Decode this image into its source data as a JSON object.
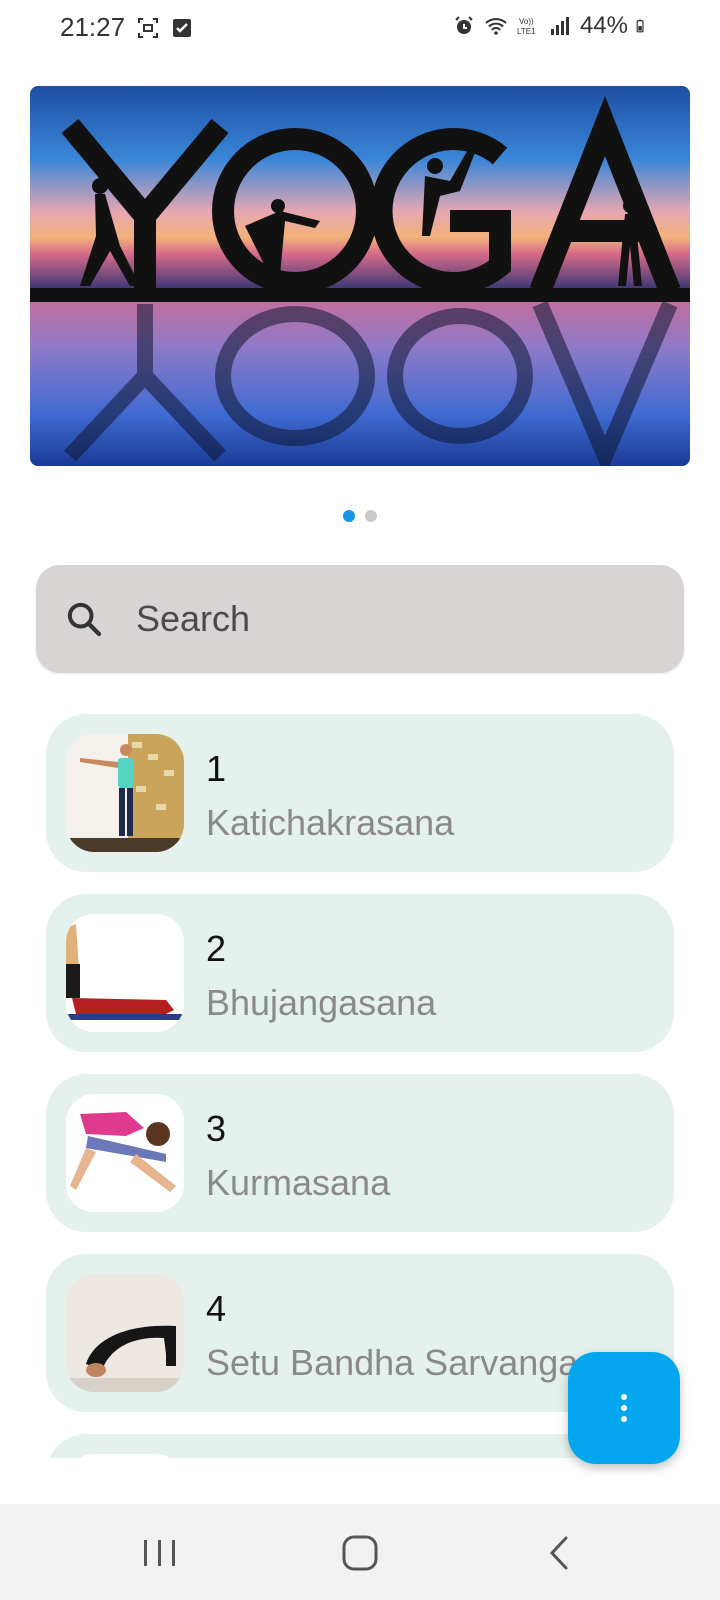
{
  "status_bar": {
    "time": "21:27",
    "battery": "44%",
    "icons": [
      "screenshot-icon",
      "checkbox-icon",
      "alarm-icon",
      "wifi-icon",
      "volte-icon",
      "signal-icon",
      "battery-icon"
    ]
  },
  "banner": {
    "image": "yoga-banner",
    "pages": 2,
    "active_page": 1
  },
  "search": {
    "placeholder": "Search"
  },
  "list": {
    "items": [
      {
        "number": "1",
        "name": "Katichakrasana"
      },
      {
        "number": "2",
        "name": "Bhujangasana"
      },
      {
        "number": "3",
        "name": "Kurmasana"
      },
      {
        "number": "4",
        "name": "Setu Bandha Sarvanga"
      }
    ]
  },
  "fab": {
    "icon": "more-vertical-icon",
    "color": "#04a6f0"
  },
  "nav_bar": {
    "buttons": [
      "recent-apps-icon",
      "home-icon",
      "back-icon"
    ]
  },
  "colors": {
    "card_bg": "#e5f1ec",
    "search_bg": "#d8d4d4",
    "accent": "#1597e5"
  }
}
